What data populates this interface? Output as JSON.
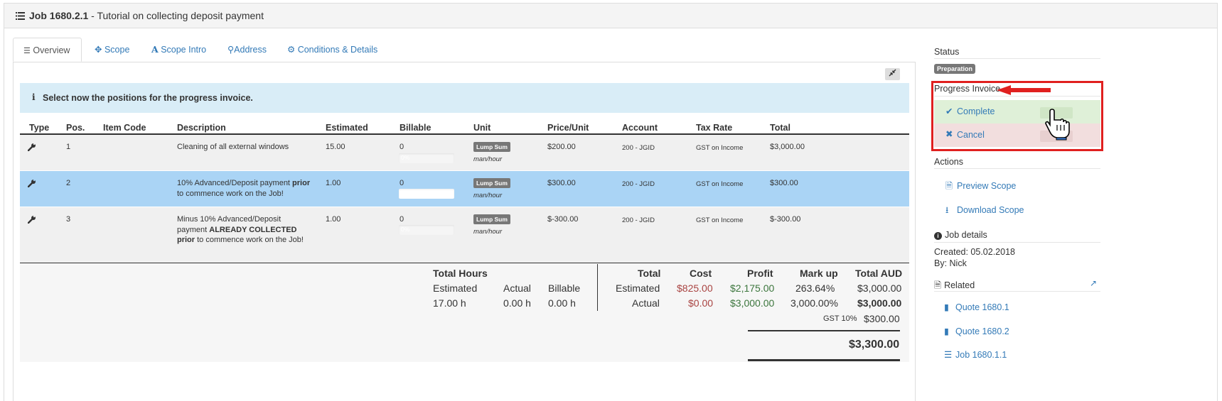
{
  "header": {
    "job_number": "Job 1680.2.1",
    "title_separator": " - ",
    "title": "Tutorial on collecting deposit payment"
  },
  "tabs": [
    {
      "label": "Overview",
      "icon": "list-icon",
      "active": true
    },
    {
      "label": "Scope",
      "icon": "crosshairs-icon",
      "active": false
    },
    {
      "label": "Scope Intro",
      "icon": "font-icon",
      "active": false
    },
    {
      "label": "Address",
      "icon": "map-marker-icon",
      "active": false
    },
    {
      "label": "Conditions & Details",
      "icon": "cogs-icon",
      "active": false
    }
  ],
  "info_message": "Select now the positions for the progress invoice.",
  "table": {
    "headers": [
      "Type",
      "Pos.",
      "Item Code",
      "Description",
      "Estimated",
      "Billable",
      "Unit",
      "Price/Unit",
      "Account",
      "Tax Rate",
      "Total"
    ],
    "rows": [
      {
        "pos": "1",
        "item_code": "",
        "description_html": "Cleaning of all external windows",
        "estimated": "15.00",
        "billable": "0",
        "progress": "0%",
        "unit": "Lump Sum",
        "unit_sub": "man/hour",
        "price": "$200.00",
        "account": "200 - JGID",
        "tax": "GST on Income",
        "total": "$3,000.00",
        "selected": false
      },
      {
        "pos": "2",
        "item_code": "",
        "description_html": "10% Advanced/Deposit payment <b>prior</b> to commence work on the Job!",
        "estimated": "1.00",
        "billable": "0",
        "progress": "0%",
        "unit": "Lump Sum",
        "unit_sub": "man/hour",
        "price": "$300.00",
        "account": "200 - JGID",
        "tax": "GST on Income",
        "total": "$300.00",
        "selected": true
      },
      {
        "pos": "3",
        "item_code": "",
        "description_html": "Minus 10% Advanced/Deposit payment <b>ALREADY COLLECTED prior</b> to commence work on the Job!",
        "estimated": "1.00",
        "billable": "0",
        "progress": "0%",
        "unit": "Lump Sum",
        "unit_sub": "man/hour",
        "price": "$-300.00",
        "account": "200 - JGID",
        "tax": "GST on Income",
        "total": "$-300.00",
        "selected": false
      }
    ]
  },
  "totals": {
    "hours_title": "Total Hours",
    "hours_headers": [
      "Estimated",
      "Actual",
      "Billable"
    ],
    "hours_values": [
      "17.00 h",
      "0.00 h",
      "0.00 h"
    ],
    "money_headers": [
      "Total",
      "Cost",
      "Profit",
      "Mark up",
      "Total AUD"
    ],
    "estimated_row": {
      "label": "Estimated",
      "cost": "$825.00",
      "profit": "$2,175.00",
      "markup": "263.64%",
      "total": "$3,000.00"
    },
    "actual_row": {
      "label": "Actual",
      "cost": "$0.00",
      "profit": "$3,000.00",
      "markup": "3,000.00%",
      "total": "$3,000.00"
    },
    "gst_label": "GST 10%",
    "gst_value": "$300.00",
    "grand_total": "$3,300.00"
  },
  "sidebar": {
    "status_label": "Status",
    "status_badge": "Preparation",
    "progress_label": "Progress Invoice",
    "complete_label": "Complete",
    "cancel_label": "Cancel",
    "actions_label": "Actions",
    "preview_label": "Preview Scope",
    "download_label": "Download Scope",
    "job_details_label": "Job details",
    "created": "Created: 05.02.2018",
    "by": "By: Nick",
    "related_label": "Related",
    "related": [
      "Quote 1680.1",
      "Quote 1680.2",
      "Job 1680.1.1"
    ]
  },
  "colors": {
    "link": "#337ab7",
    "highlight_box": "#e0201f",
    "info_bg": "#d9edf7",
    "selected_row": "#aad4f5",
    "complete_bg": "#dff0d8",
    "cancel_bg": "#f2dede"
  }
}
